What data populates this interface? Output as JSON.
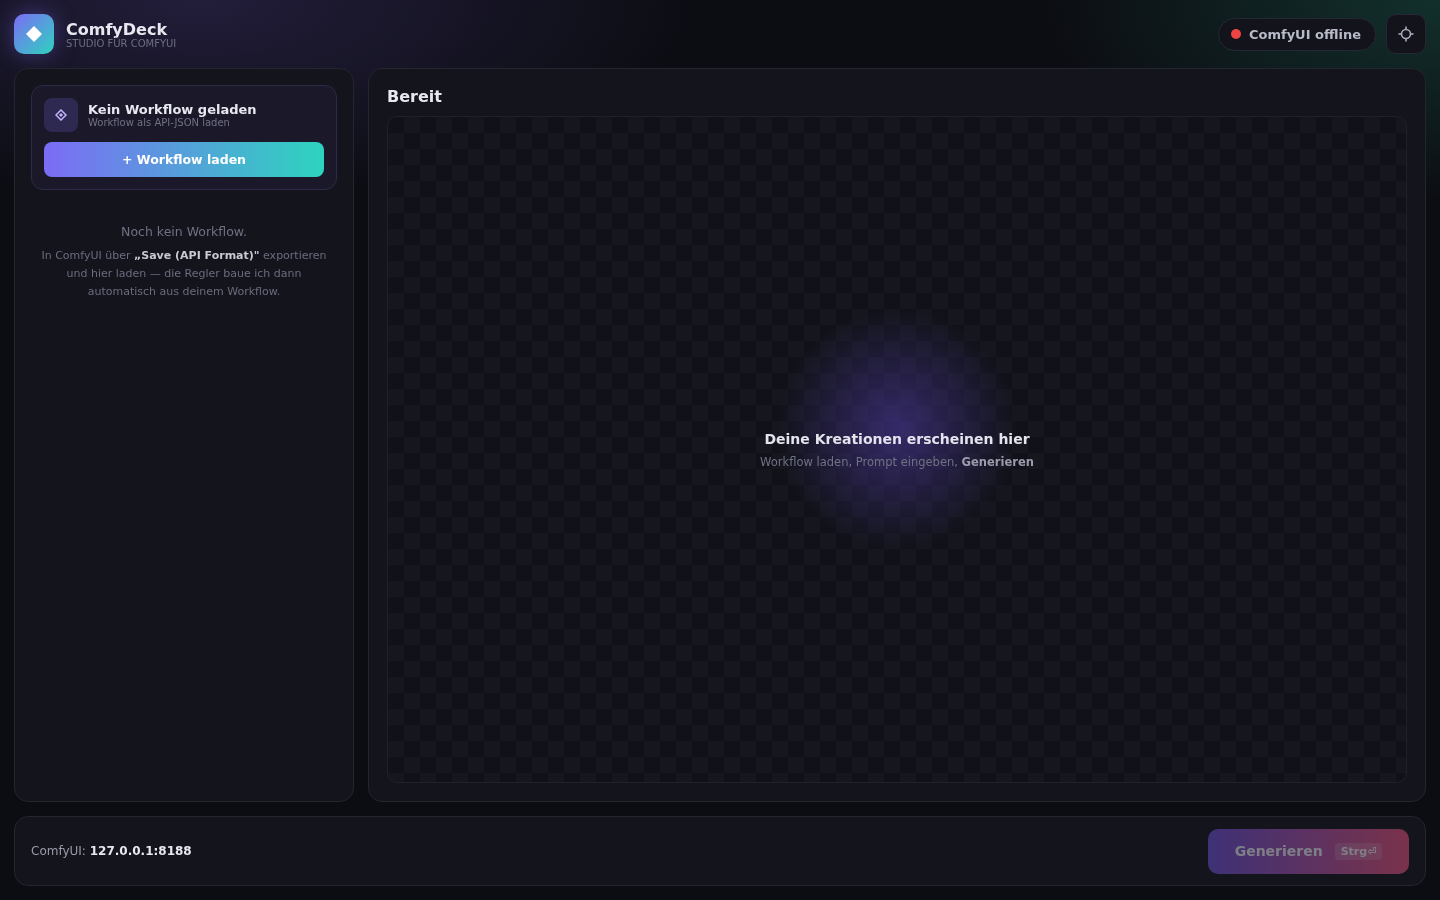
{
  "brand": {
    "name": "ComfyDeck",
    "tagline": "STUDIO FÜR COMFYUI"
  },
  "connection": {
    "label": "ComfyUI offline",
    "color": "#ef4444"
  },
  "workflow_card": {
    "title": "Kein Workflow geladen",
    "subtitle": "Workflow als API-JSON laden",
    "button": "+ Workflow laden"
  },
  "sidebar_empty": {
    "title": "Noch kein Workflow.",
    "text": "In ComfyUI über **„Save (API Format)\"** exportieren und hier laden — die Regler baue ich dann automatisch aus deinem Workflow."
  },
  "canvas": {
    "title": "Bereit",
    "empty_title": "Deine Kreationen erscheinen hier",
    "empty_text": "Workflow laden, Prompt eingeben, **Generieren**"
  },
  "footer": {
    "server_label": "ComfyUI:",
    "server": "127.0.0.1:8188",
    "generate": {
      "label": "Generieren",
      "shortcut": "Strg⏎",
      "disabled": true
    }
  }
}
